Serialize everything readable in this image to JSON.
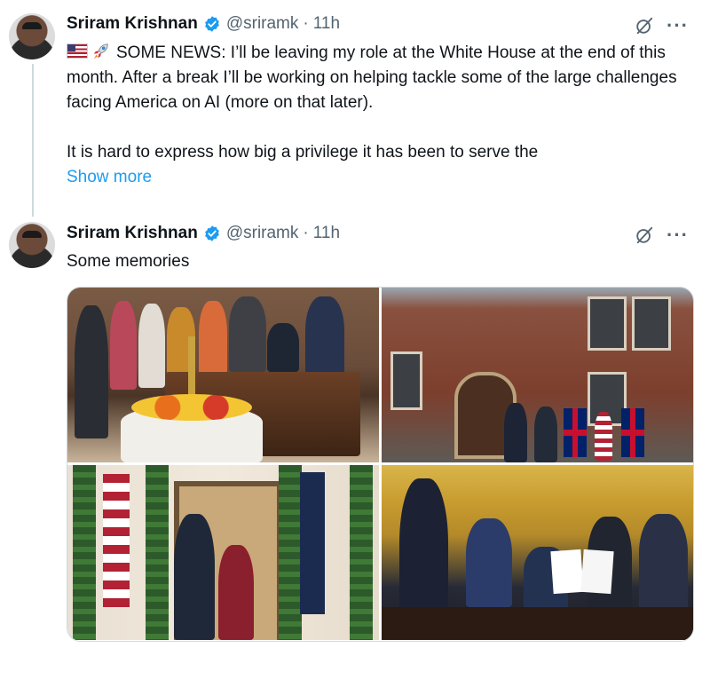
{
  "tweets": [
    {
      "name": "Sriram Krishnan",
      "handle": "@sriramk",
      "separator": "·",
      "time": "11h",
      "text": "SOME NEWS: I’ll be leaving my role at the White House at the end of this month. After a break I’ll be working on helping tackle some of the large challenges facing America on AI (more on that later).",
      "text2": "It is hard to express how big a privilege it has been to serve the",
      "show_more": "Show more",
      "emojis": [
        "us-flag-emoji",
        "rocket-emoji"
      ]
    },
    {
      "name": "Sriram Krishnan",
      "handle": "@sriramk",
      "separator": "·",
      "time": "11h",
      "text": "Some memories",
      "photos": [
        "oval-office-diwali-photo",
        "manor-house-flags-photo",
        "holiday-hallway-photo",
        "oval-office-signing-photo"
      ]
    }
  ],
  "icons": {
    "verified": "verified-badge-icon",
    "grok": "grok-icon",
    "more": "more-options-icon",
    "more_glyph": "···"
  },
  "colors": {
    "text": "#0f1419",
    "secondary": "#536471",
    "link": "#1d9bf0",
    "verified": "#1d9bf0"
  }
}
